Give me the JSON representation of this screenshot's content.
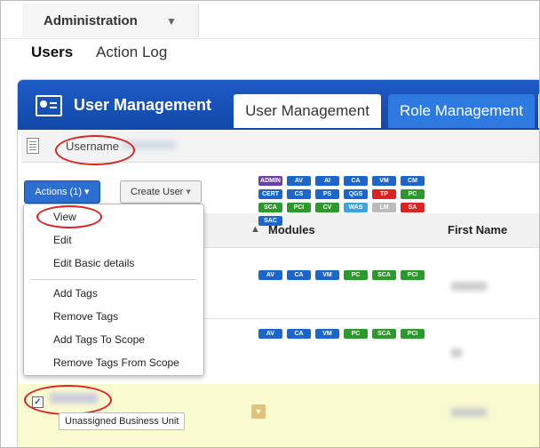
{
  "topbar": {
    "module_label": "Administration"
  },
  "nav_tabs": [
    "Users",
    "Action Log"
  ],
  "header": {
    "title": "User Management",
    "tabs": [
      "User Management",
      "Role Management"
    ]
  },
  "search": {
    "label": "Username"
  },
  "toolbar": {
    "actions_label": "Actions (1)",
    "create_label": "Create User"
  },
  "grid": {
    "columns": [
      "Modules",
      "First Name"
    ]
  },
  "menu": {
    "items": [
      "View",
      "Edit",
      "Edit Basic details",
      "Add Tags",
      "Remove Tags",
      "Add Tags To Scope",
      "Remove Tags From Scope"
    ]
  },
  "rows": [
    {
      "modules": [
        {
          "n": "ADMIN",
          "c": "#6b3fa8"
        },
        {
          "n": "AV",
          "c": "#1a66cc"
        },
        {
          "n": "AI",
          "c": "#1a66cc"
        },
        {
          "n": "CA",
          "c": "#1a66cc"
        },
        {
          "n": "VM",
          "c": "#1a66cc"
        },
        {
          "n": "CM",
          "c": "#1a66cc"
        },
        {
          "n": "CERT",
          "c": "#1a66cc"
        },
        {
          "n": "CS",
          "c": "#1a66cc"
        },
        {
          "n": "PS",
          "c": "#1a66cc"
        },
        {
          "n": "QGS",
          "c": "#1a66cc"
        },
        {
          "n": "TP",
          "c": "#d22"
        },
        {
          "n": "PC",
          "c": "#2a9a2a"
        },
        {
          "n": "SCA",
          "c": "#2a9a2a"
        },
        {
          "n": "PCI",
          "c": "#2a9a2a"
        },
        {
          "n": "CV",
          "c": "#2a9a2a"
        },
        {
          "n": "WAS",
          "c": "#3aa5e0"
        },
        {
          "n": "LM",
          "c": "#bbbbbb"
        },
        {
          "n": "SA",
          "c": "#d22"
        },
        {
          "n": "SAC",
          "c": "#1a66cc"
        }
      ]
    },
    {
      "modules": [
        {
          "n": "AV",
          "c": "#1a66cc"
        },
        {
          "n": "CA",
          "c": "#1a66cc"
        },
        {
          "n": "VM",
          "c": "#1a66cc"
        },
        {
          "n": "PC",
          "c": "#2a9a2a"
        },
        {
          "n": "SCA",
          "c": "#2a9a2a"
        },
        {
          "n": "PCI",
          "c": "#2a9a2a"
        }
      ]
    },
    {
      "business_unit": "Unassigned Business Unit",
      "modules": [
        {
          "n": "AV",
          "c": "#1a66cc"
        },
        {
          "n": "CA",
          "c": "#1a66cc"
        },
        {
          "n": "VM",
          "c": "#1a66cc"
        },
        {
          "n": "PC",
          "c": "#2a9a2a"
        },
        {
          "n": "SCA",
          "c": "#2a9a2a"
        },
        {
          "n": "PCI",
          "c": "#2a9a2a"
        }
      ]
    }
  ]
}
